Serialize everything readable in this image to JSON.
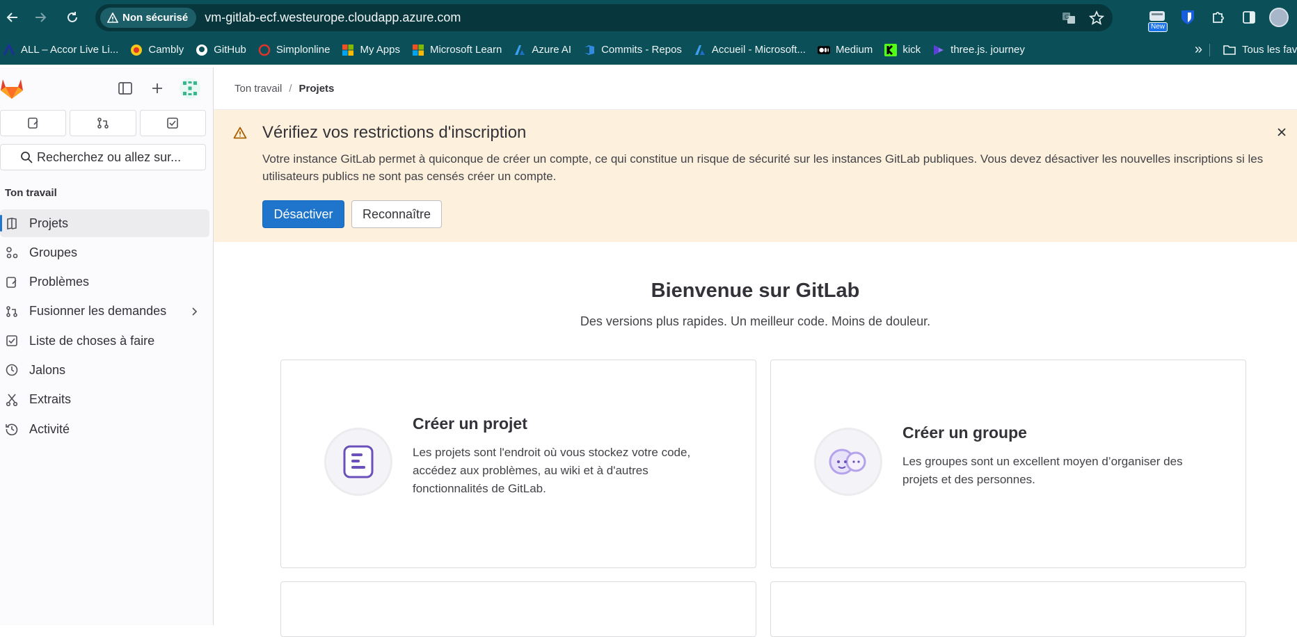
{
  "browser": {
    "security_label": "Non sécurisé",
    "url": "vm-gitlab-ecf.westeurope.cloudapp.azure.com",
    "new_badge": "New",
    "bookmarks": [
      {
        "label": "ALL – Accor Live Li...",
        "icon": "accor-icon"
      },
      {
        "label": "Cambly",
        "icon": "cambly-icon"
      },
      {
        "label": "GitHub",
        "icon": "github-icon"
      },
      {
        "label": "Simplonline",
        "icon": "simplon-icon"
      },
      {
        "label": "My Apps",
        "icon": "microsoft-icon"
      },
      {
        "label": "Microsoft Learn",
        "icon": "microsoft-icon"
      },
      {
        "label": "Azure AI",
        "icon": "azure-icon"
      },
      {
        "label": "Commits - Repos",
        "icon": "azure-devops-icon"
      },
      {
        "label": "Accueil - Microsoft...",
        "icon": "azure-icon"
      },
      {
        "label": "Medium",
        "icon": "medium-icon"
      },
      {
        "label": "kick",
        "icon": "kick-icon"
      },
      {
        "label": "three.js. journey",
        "icon": "threejs-icon"
      }
    ],
    "folder_label": "Tous les favoris"
  },
  "sidebar": {
    "search_placeholder": "Recherchez ou allez sur...",
    "section_title": "Ton travail",
    "items": [
      {
        "label": "Projets",
        "icon": "project-icon",
        "active": true
      },
      {
        "label": "Groupes",
        "icon": "group-icon"
      },
      {
        "label": "Problèmes",
        "icon": "issues-icon"
      },
      {
        "label": "Fusionner les demandes",
        "icon": "merge-request-icon",
        "has_children": true
      },
      {
        "label": "Liste de choses à faire",
        "icon": "todo-icon"
      },
      {
        "label": "Jalons",
        "icon": "milestone-icon"
      },
      {
        "label": "Extraits",
        "icon": "snippet-icon"
      },
      {
        "label": "Activité",
        "icon": "history-icon"
      }
    ]
  },
  "breadcrumb": {
    "parent": "Ton travail",
    "current": "Projets"
  },
  "alert": {
    "title": "Vérifiez vos restrictions d'inscription",
    "body": "Votre instance GitLab permet à quiconque de créer un compte, ce qui constitue un risque de sécurité sur les instances GitLab publiques. Vous devez désactiver les nouvelles inscriptions si les utilisateurs publics ne sont pas censés créer un compte.",
    "primary_label": "Désactiver",
    "secondary_label": "Reconnaître"
  },
  "welcome": {
    "title": "Bienvenue sur GitLab",
    "subtitle": "Des versions plus rapides. Un meilleur code. Moins de douleur."
  },
  "cards": [
    {
      "title": "Créer un projet",
      "description": "Les projets sont l'endroit où vous stockez votre code, accédez aux problèmes, au wiki et à d'autres fonctionnalités de GitLab."
    },
    {
      "title": "Créer un groupe",
      "description": "Les groupes sont un excellent moyen d’organiser des projets et des personnes."
    }
  ],
  "colors": {
    "chrome": "#0b4f59",
    "primary": "#1f75cb",
    "alert_bg": "#fdf1dd",
    "warning": "#ab6100"
  }
}
